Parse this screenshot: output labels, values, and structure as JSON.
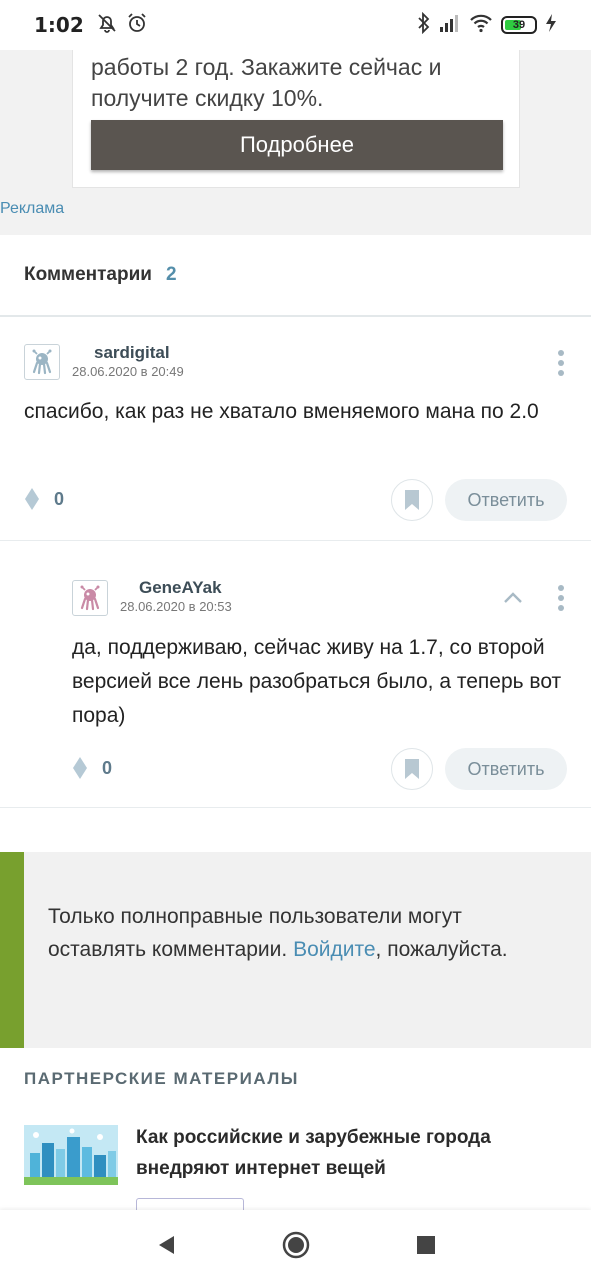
{
  "status_bar": {
    "time": "1:02",
    "battery_level": "39"
  },
  "ad": {
    "text": "работы 2 год. Закажите сейчас и получите скидку 10%.",
    "button_label": "Подробнее",
    "label": "Реклама"
  },
  "comments_section": {
    "title": "Комментарии",
    "count": "2"
  },
  "comments": [
    {
      "username": "sardigital",
      "datetime": "28.06.2020 в 20:49",
      "text": "спасибо, как раз не хватало вменяемого мана по 2.0",
      "votes": "0",
      "reply_label": "Ответить"
    },
    {
      "username": "GeneAYak",
      "datetime": "28.06.2020 в 20:53",
      "text": "да, поддерживаю, сейчас живу на 1.7, со второй версией все лень разобраться было, а теперь вот пора)",
      "votes": "0",
      "reply_label": "Ответить"
    }
  ],
  "login_notice": {
    "before": "Только полноправные пользователи могут оставлять комментарии. ",
    "link": "Войдите",
    "after": ", пожалуйста."
  },
  "partners": {
    "title": "ПАРТНЕРСКИЕ МАТЕРИАЛЫ",
    "items": [
      {
        "title": "Как российские и зарубежные города внедряют интернет вещей"
      }
    ]
  },
  "colors": {
    "accent": "#4a8db3",
    "notice_bar": "#78a02e",
    "ad_button": "#5a5550"
  }
}
